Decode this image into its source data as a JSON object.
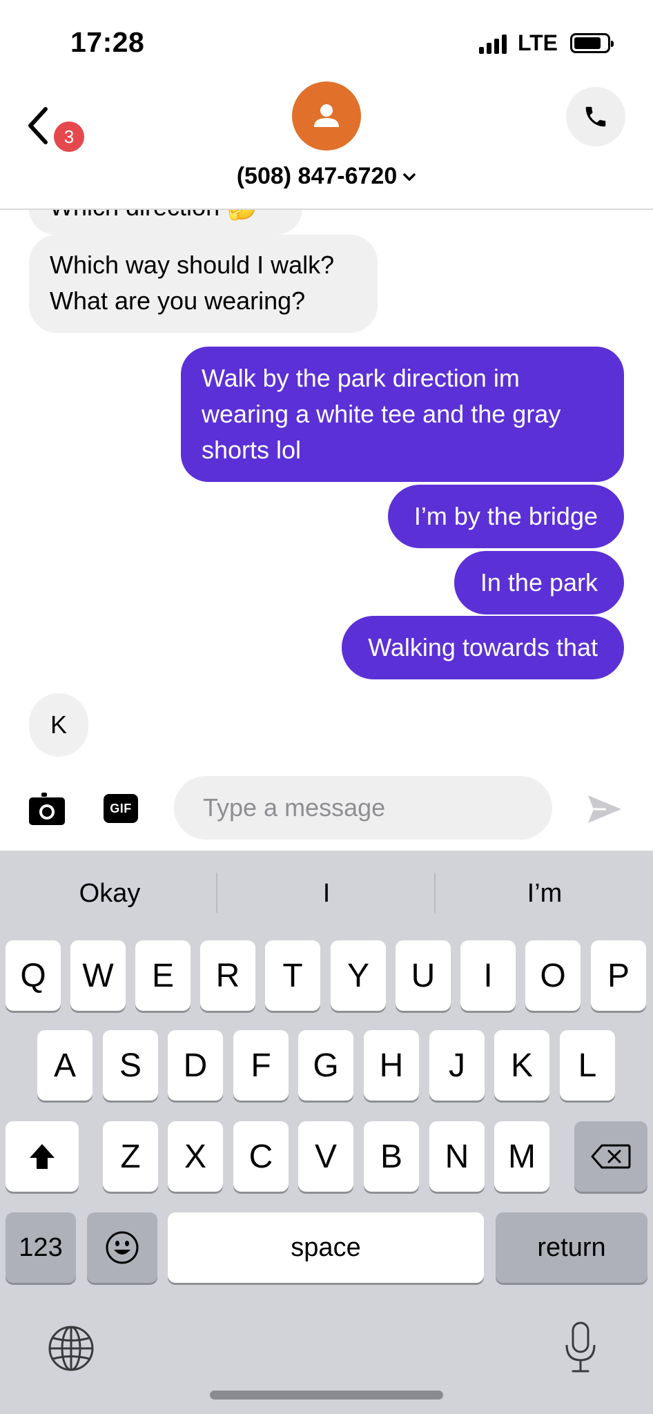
{
  "status": {
    "time": "17:28",
    "network": "LTE",
    "icons": [
      "signal-bars-icon",
      "battery-icon"
    ]
  },
  "header": {
    "back_icon": "chevron-left-icon",
    "unread_count": "3",
    "avatar_icon": "person-icon",
    "contact": "(508) 847-6720",
    "contact_dropdown_icon": "chevron-down-icon",
    "call_icon": "phone-icon"
  },
  "messages": [
    {
      "direction": "incoming",
      "text": "Which direction 🤔",
      "partial": true
    },
    {
      "direction": "incoming",
      "text": "Which way should I walk?\nWhat are you wearing?"
    },
    {
      "direction": "outgoing",
      "text": "Walk by the park direction im wearing a white tee and the gray shorts lol"
    },
    {
      "direction": "outgoing",
      "text": "I’m by the bridge"
    },
    {
      "direction": "outgoing",
      "text": "In the park"
    },
    {
      "direction": "outgoing",
      "text": "Walking towards that"
    },
    {
      "direction": "incoming",
      "text": "K"
    }
  ],
  "composer": {
    "camera_icon": "camera-icon",
    "gif_label": "GIF",
    "placeholder": "Type a message",
    "value": "",
    "send_icon": "send-arrow-icon"
  },
  "keyboard": {
    "suggestions": [
      "Okay",
      "I",
      "I’m"
    ],
    "row1": [
      "Q",
      "W",
      "E",
      "R",
      "T",
      "Y",
      "U",
      "I",
      "O",
      "P"
    ],
    "row2": [
      "A",
      "S",
      "D",
      "F",
      "G",
      "H",
      "J",
      "K",
      "L"
    ],
    "row3": [
      "Z",
      "X",
      "C",
      "V",
      "B",
      "N",
      "M"
    ],
    "shift_icon": "shift-arrow-icon",
    "delete_icon": "backspace-icon",
    "numbers_label": "123",
    "emoji_icon": "emoji-face-icon",
    "space_label": "space",
    "return_label": "return",
    "globe_icon": "globe-icon",
    "mic_icon": "microphone-icon"
  },
  "colors": {
    "outgoing_bubble": "#5b30d6",
    "incoming_bubble": "#f0f0f0",
    "avatar": "#e1702b",
    "badge": "#e5484d",
    "keyboard_bg": "#d1d3d9"
  }
}
